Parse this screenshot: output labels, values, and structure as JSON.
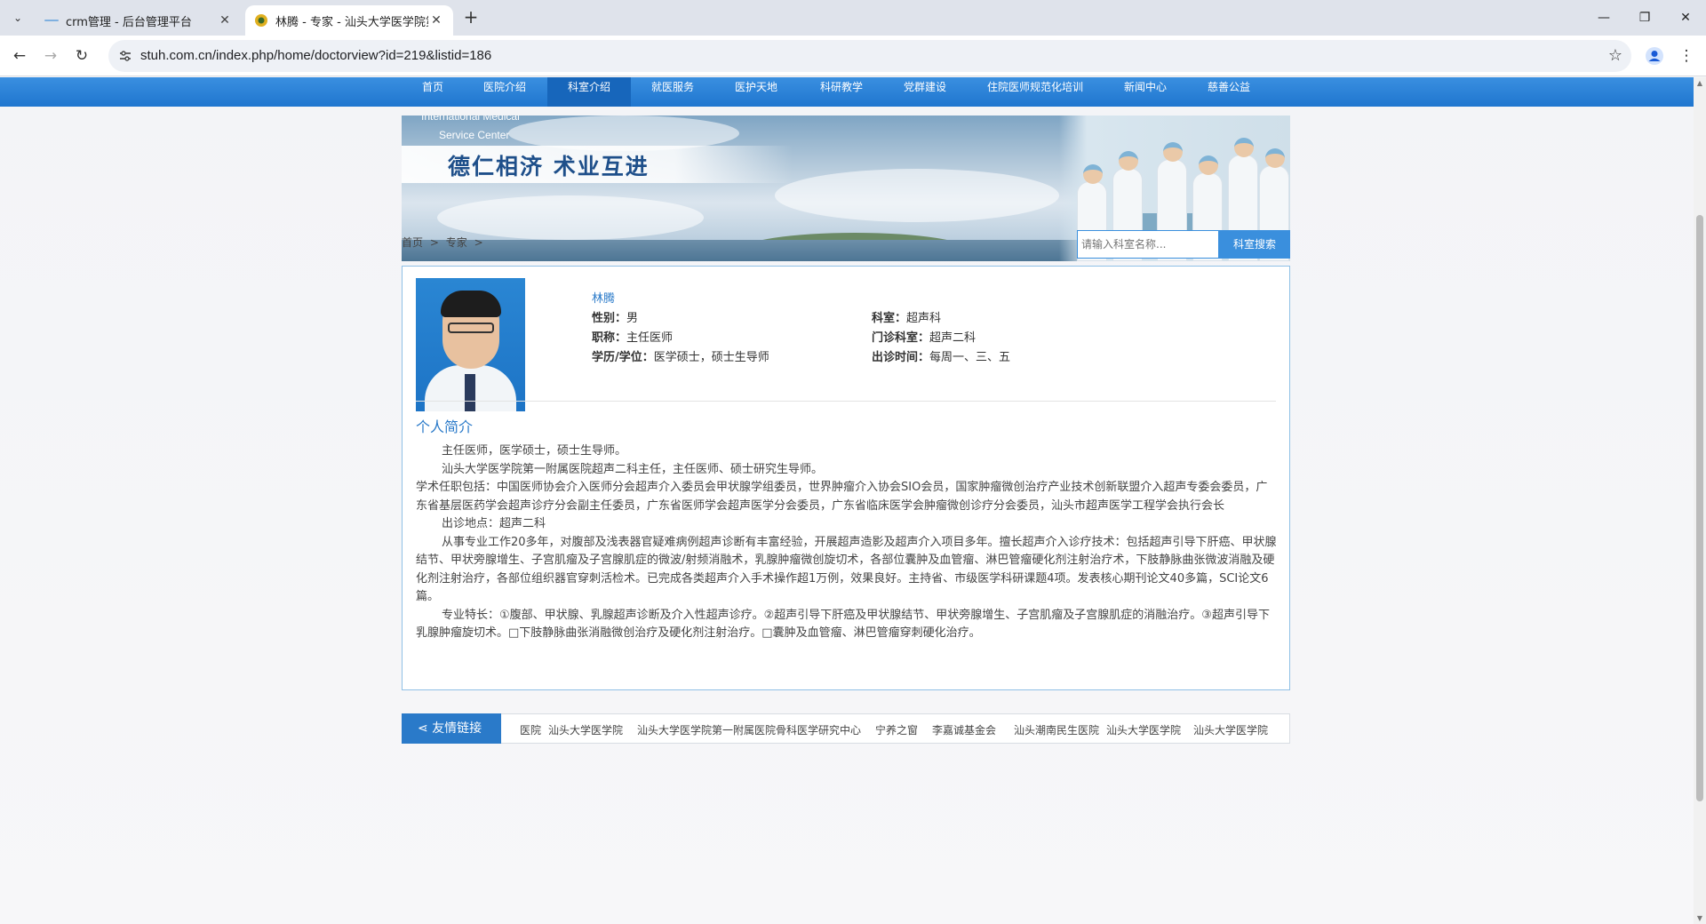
{
  "browser": {
    "tabs": [
      {
        "title": "crm管理 - 后台管理平台",
        "active": false
      },
      {
        "title": "林腾 - 专家 - 汕头大学医学院第一附属医院",
        "active": true
      }
    ],
    "url": "stuh.com.cn/index.php/home/doctorview?id=219&listid=186"
  },
  "nav": {
    "items": [
      "首页",
      "医院介绍",
      "科室介绍",
      "就医服务",
      "医护天地",
      "科研教学",
      "党群建设",
      "住院医师规范化培训",
      "新闻中心",
      "慈善公益"
    ],
    "active_index": 2,
    "accent_color": "#1f76cf"
  },
  "banner": {
    "en_line1": "International Medical",
    "en_line2": "Service Center",
    "slogan": "德仁相济 术业互进"
  },
  "breadcrumb": [
    "首页",
    ">",
    "专家",
    ">"
  ],
  "search": {
    "placeholder": "请输入科室名称...",
    "button_label": "科室搜索"
  },
  "doctor": {
    "name": "林腾",
    "gender_label": "性别：",
    "gender": "男",
    "dept_label": "科室：",
    "dept": "超声科",
    "title_label": "职称：",
    "title": "主任医师",
    "clinic_label": "门诊科室：",
    "clinic": "超声二科",
    "degree_label": "学历/学位：",
    "degree": "医学硕士，硕士生导师",
    "schedule_label": "出诊时间：",
    "schedule": "每周一、三、五"
  },
  "bio": {
    "section_title": "个人简介",
    "paragraphs": [
      "主任医师，医学硕士，硕士生导师。",
      "汕头大学医学院第一附属医院超声二科主任，主任医师、硕士研究生导师。",
      "学术任职包括：中国医师协会介入医师分会超声介入委员会甲状腺学组委员，世界肿瘤介入协会SIO会员，国家肿瘤微创治疗产业技术创新联盟介入超声专委会委员，广东省基层医药学会超声诊疗分会副主任委员，广东省医师学会超声医学分会委员，广东省临床医学会肿瘤微创诊疗分会委员，汕头市超声医学工程学会执行会长",
      "出诊地点：超声二科",
      "从事专业工作20多年，对腹部及浅表器官疑难病例超声诊断有丰富经验，开展超声造影及超声介入项目多年。擅长超声介入诊疗技术：包括超声引导下肝癌、甲状腺结节、甲状旁腺增生、子宫肌瘤及子宫腺肌症的微波/射频消融术，乳腺肿瘤微创旋切术，各部位囊肿及血管瘤、淋巴管瘤硬化剂注射治疗术，下肢静脉曲张微波消融及硬化剂注射治疗，各部位组织器官穿刺活检术。已完成各类超声介入手术操作超1万例，效果良好。主持省、市级医学科研课题4项。发表核心期刊论文40多篇，SCI论文6篇。",
      "专业特长：①腹部、甲状腺、乳腺超声诊断及介入性超声诊疗。②超声引导下肝癌及甲状腺结节、甲状旁腺增生、子宫肌瘤及子宫腺肌症的消融治疗。③超声引导下乳腺肿瘤旋切术。□下肢静脉曲张消融微创治疗及硬化剂注射治疗。□囊肿及血管瘤、淋巴管瘤穿刺硬化治疗。"
    ]
  },
  "links": {
    "header": "友情链接",
    "items": [
      "医院",
      "汕头大学医学院",
      "汕头大学医学院第一附属医院骨科医学研究中心",
      "宁养之窗",
      "李嘉诚基金会",
      "汕头潮南民生医院",
      "汕头大学医学院",
      "汕头大学医学院"
    ]
  }
}
